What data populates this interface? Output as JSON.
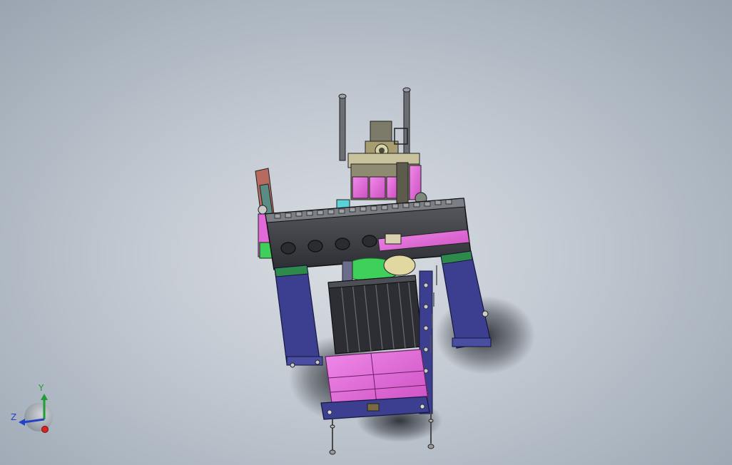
{
  "viewport": {
    "background": "#bfc6ce",
    "model": {
      "description_icon": "assembly-machine-model",
      "colors": {
        "beam": "#3e4046",
        "frame_blue": "#3c3f8f",
        "magenta": "#e26ad8",
        "green": "#3ed05a",
        "olive": "#9a8a4e",
        "red_tan": "#b86a5e"
      }
    }
  },
  "triad": {
    "y_label": "Y",
    "z_label": "Z",
    "colors": {
      "x": "#d92424",
      "y": "#1f9d35",
      "z": "#2740c8"
    }
  }
}
